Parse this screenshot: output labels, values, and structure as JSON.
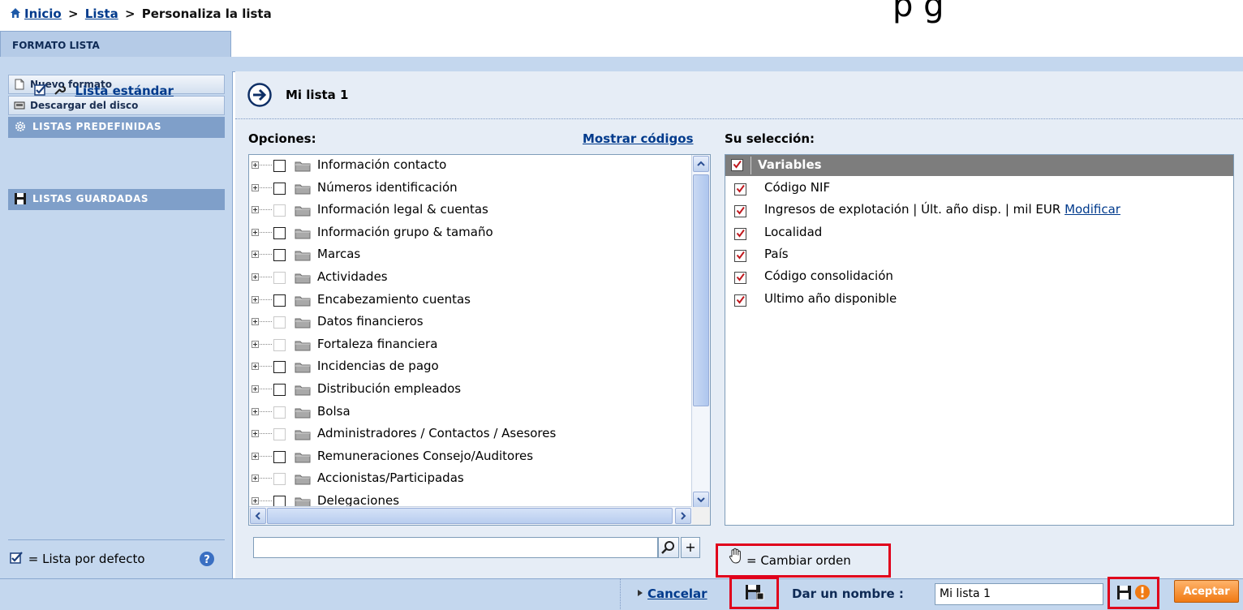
{
  "breadcrumb": {
    "home": "Inicio",
    "sep1": ">",
    "lista": "Lista",
    "sep2": ">",
    "current": "Personaliza la lista"
  },
  "top_fragment_text": "p  g",
  "tab": {
    "label": "FORMATO LISTA"
  },
  "left_panel": {
    "nuevo_formato": "Nuevo formato",
    "descargar_disco": "Descargar del disco",
    "listas_predefinidas": "LISTAS PREDEFINIDAS",
    "lista_estandar": "Lista estándar",
    "listas_guardadas": "LISTAS GUARDADAS",
    "footer_legend": "= Lista por defecto"
  },
  "main": {
    "list_title": "Mi lista 1",
    "opciones_label": "Opciones:",
    "mostrar_codigos": "Mostrar códigos",
    "su_seleccion_label": "Su selección:"
  },
  "options_tree": [
    {
      "label": "Información contacto",
      "checkbox_enabled": true
    },
    {
      "label": "Números identificación",
      "checkbox_enabled": true
    },
    {
      "label": "Información legal & cuentas",
      "checkbox_enabled": false
    },
    {
      "label": "Información grupo & tamaño",
      "checkbox_enabled": true
    },
    {
      "label": "Marcas",
      "checkbox_enabled": true
    },
    {
      "label": "Actividades",
      "checkbox_enabled": false
    },
    {
      "label": "Encabezamiento cuentas",
      "checkbox_enabled": true
    },
    {
      "label": "Datos financieros",
      "checkbox_enabled": false
    },
    {
      "label": "Fortaleza financiera",
      "checkbox_enabled": false
    },
    {
      "label": "Incidencias de pago",
      "checkbox_enabled": true
    },
    {
      "label": "Distribución empleados",
      "checkbox_enabled": true
    },
    {
      "label": "Bolsa",
      "checkbox_enabled": false
    },
    {
      "label": "Administradores / Contactos / Asesores",
      "checkbox_enabled": false
    },
    {
      "label": "Remuneraciones Consejo/Auditores",
      "checkbox_enabled": true
    },
    {
      "label": "Accionistas/Participadas",
      "checkbox_enabled": false
    },
    {
      "label": "Delegaciones",
      "checkbox_enabled": true
    }
  ],
  "selection": {
    "header": "Variables",
    "items": [
      {
        "label": "Código NIF",
        "checked": true
      },
      {
        "label": "Ingresos de explotación | Últ. año disp. | mil EUR",
        "link": "Modificar",
        "checked": true
      },
      {
        "label": "Localidad",
        "checked": true
      },
      {
        "label": "País",
        "checked": true
      },
      {
        "label": "Código consolidación",
        "checked": true
      },
      {
        "label": "Ultimo año disponible",
        "checked": true
      }
    ]
  },
  "search": {
    "value": "",
    "plus_label": "+"
  },
  "cambiar_orden_legend": "= Cambiar orden",
  "bottom_bar": {
    "cancelar": "Cancelar",
    "dar_nombre_label": "Dar un nombre :",
    "nombre_value": "Mi lista 1",
    "aceptar": "Aceptar"
  },
  "colors": {
    "accent_orange": "#f07a14",
    "highlight_red": "#e0001b",
    "panel_blue": "#c4d7ee",
    "header_gray": "#7d7d7d",
    "check_red": "#c0181e"
  }
}
